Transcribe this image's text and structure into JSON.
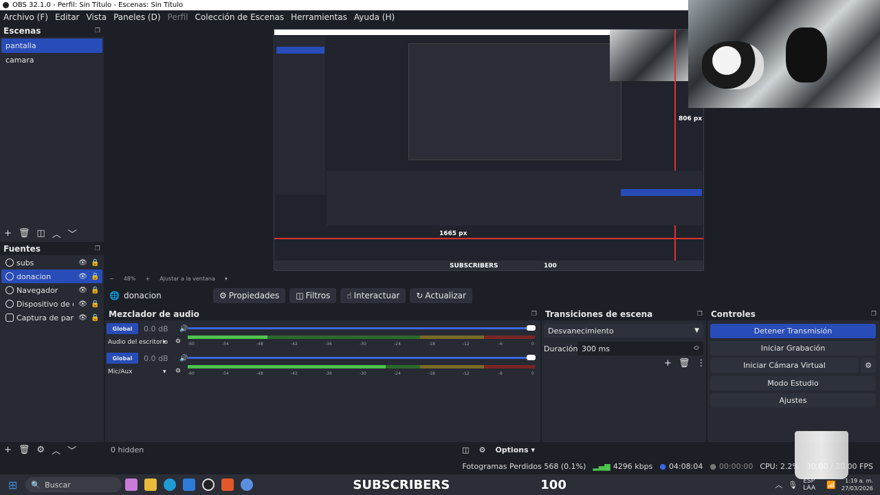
{
  "window": {
    "title": "OBS 32.1.0 - Perfil: Sin Título - Escenas: Sin Título"
  },
  "menu": [
    {
      "label": "Archivo (F)",
      "disabled": false
    },
    {
      "label": "Editar",
      "disabled": false
    },
    {
      "label": "Vista",
      "disabled": false
    },
    {
      "label": "Paneles (D)",
      "disabled": false
    },
    {
      "label": "Perfil",
      "disabled": true
    },
    {
      "label": "Colección de Escenas",
      "disabled": false
    },
    {
      "label": "Herramientas",
      "disabled": false
    },
    {
      "label": "Ayuda (H)",
      "disabled": false
    }
  ],
  "scenes": {
    "title": "Escenas",
    "items": [
      "pantalla",
      "camara"
    ],
    "selected": "pantalla"
  },
  "sources": {
    "title": "Fuentes",
    "items": [
      {
        "name": "subs",
        "icon": "globe-icon"
      },
      {
        "name": "donacion",
        "icon": "globe-icon"
      },
      {
        "name": "Navegador",
        "icon": "globe-icon"
      },
      {
        "name": "Dispositivo de capt",
        "icon": "camera-icon"
      },
      {
        "name": "Captura de pantalla",
        "icon": "monitor-icon"
      }
    ],
    "selected": "donacion"
  },
  "preview": {
    "zoom": "48%",
    "fit": "Ajustar a la ventana",
    "nested": {
      "size_label_width": "1665 px",
      "size_label_height": "806 px",
      "overlay_text": "SUBSCRIBERS",
      "overlay_count": "100"
    }
  },
  "context": {
    "source_name": "donacion",
    "buttons": [
      "Propiedades",
      "Filtros",
      "Interactuar",
      "Actualizar"
    ]
  },
  "mixer": {
    "title": "Mezclador de audio",
    "channels": [
      {
        "badge": "Global",
        "db": "0.0 dB",
        "name": "Audio del escritorio",
        "level": 0.23
      },
      {
        "badge": "Global",
        "db": "0.0 dB",
        "name": "Mic/Aux",
        "level": 0.57
      }
    ],
    "tick_labels": [
      "-60",
      "-54",
      "-48",
      "-42",
      "-36",
      "-30",
      "-24",
      "-18",
      "-12",
      "-6",
      "0"
    ]
  },
  "transitions": {
    "title": "Transiciones de escena",
    "selected": "Desvanecimiento",
    "duration_label": "Duración",
    "duration": "300 ms"
  },
  "controls": {
    "title": "Controles",
    "buttons": [
      "Detener Transmisión",
      "Iniciar Grabación",
      "Iniciar Cámara Virtual",
      "Modo Estudio",
      "Ajustes"
    ]
  },
  "bottom_bar": {
    "hidden_label": "0 hidden",
    "options_label": "Options"
  },
  "status": {
    "dropped": "Fotogramas Perdidos 568 (0.1%)",
    "bitrate": "4296 kbps",
    "stream_time": "04:08:04",
    "rec_time": "00:00:00",
    "cpu": "CPU: 2.2%",
    "fps": "30.00 / 30.00 FPS"
  },
  "taskbar": {
    "search_placeholder": "Buscar",
    "overlay_text": "SUBSCRIBERS",
    "overlay_count": "100",
    "lang": "ESP LAA",
    "time": "1:19 a. m.",
    "date": "27/03/2026"
  },
  "colors": {
    "accent": "#284cb8",
    "bg": "#1d1f26",
    "panel": "#272a33",
    "meter_green": "#4ec34e",
    "meter_yellow": "#c9b43b",
    "meter_red": "#c93b3b"
  }
}
